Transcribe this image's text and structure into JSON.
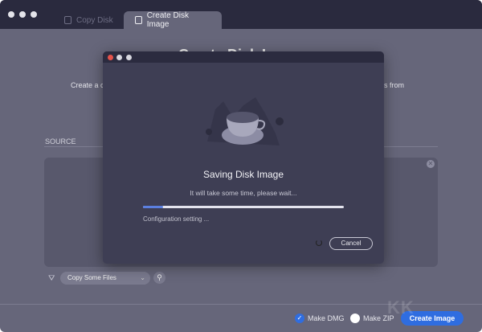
{
  "tabs": [
    {
      "label": "Copy Disk",
      "icon": "disk-icon"
    },
    {
      "label": "Create Disk Image",
      "icon": "disk-image-icon"
    }
  ],
  "main": {
    "heading": "Create Disk Image",
    "desc_left": "Create a c",
    "desc_right": "ers from",
    "source_label": "SOURCE",
    "filter_select": "Copy Some Files"
  },
  "footer": {
    "make_dmg": "Make DMG",
    "make_dmg_checked": true,
    "make_zip": "Make ZIP",
    "make_zip_checked": false,
    "create_button": "Create Image"
  },
  "watermark": "KK下载",
  "modal": {
    "title": "Saving Disk Image",
    "subtitle": "It will take some time, please wait...",
    "progress_percent": 10,
    "status": "Configuration setting ...",
    "cancel": "Cancel"
  },
  "colors": {
    "accent": "#2f6de0",
    "progress": "#5b7fe0",
    "close": "#e5534b"
  }
}
